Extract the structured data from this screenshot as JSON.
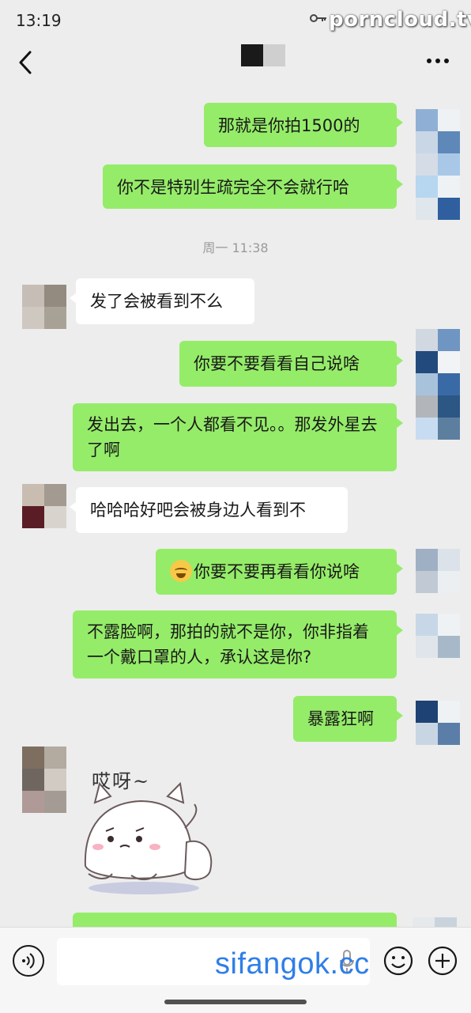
{
  "status": {
    "time": "13:19",
    "key_icon": "key-icon"
  },
  "watermarks": {
    "top": "porncloud.tv",
    "bottom": "sifangok.cc"
  },
  "nav": {
    "back_icon": "chevron-left-icon",
    "more_icon": "more-dots-icon"
  },
  "timestamp": "周一 11:38",
  "messages": [
    {
      "side": "me",
      "text": "那就是你拍1500的"
    },
    {
      "side": "me",
      "text": "你不是特别生疏完全不会就行哈"
    },
    {
      "side": "other",
      "text": "发了会被看到不么"
    },
    {
      "side": "me",
      "text": "你要不要看看自己说啥"
    },
    {
      "side": "me",
      "text": "发出去，一个人都看不见。。那发外星去了啊"
    },
    {
      "side": "other",
      "text": "哈哈哈好吧会被身边人看到不"
    },
    {
      "side": "me",
      "text": "你要不要再看看你说啥",
      "emoji": "laughing-crying-emoji"
    },
    {
      "side": "me",
      "text": "不露脸啊，那拍的就不是你，你非指着一个戴口罩的人，承认这是你?"
    },
    {
      "side": "me",
      "text": "暴露狂啊"
    }
  ],
  "sticker": {
    "caption": "哎呀~",
    "icon": "sad-cat-sticker"
  },
  "input": {
    "placeholder": ""
  },
  "colors": {
    "me_bubble": "#95ec69",
    "other_bubble": "#ffffff",
    "background": "#ededed"
  }
}
